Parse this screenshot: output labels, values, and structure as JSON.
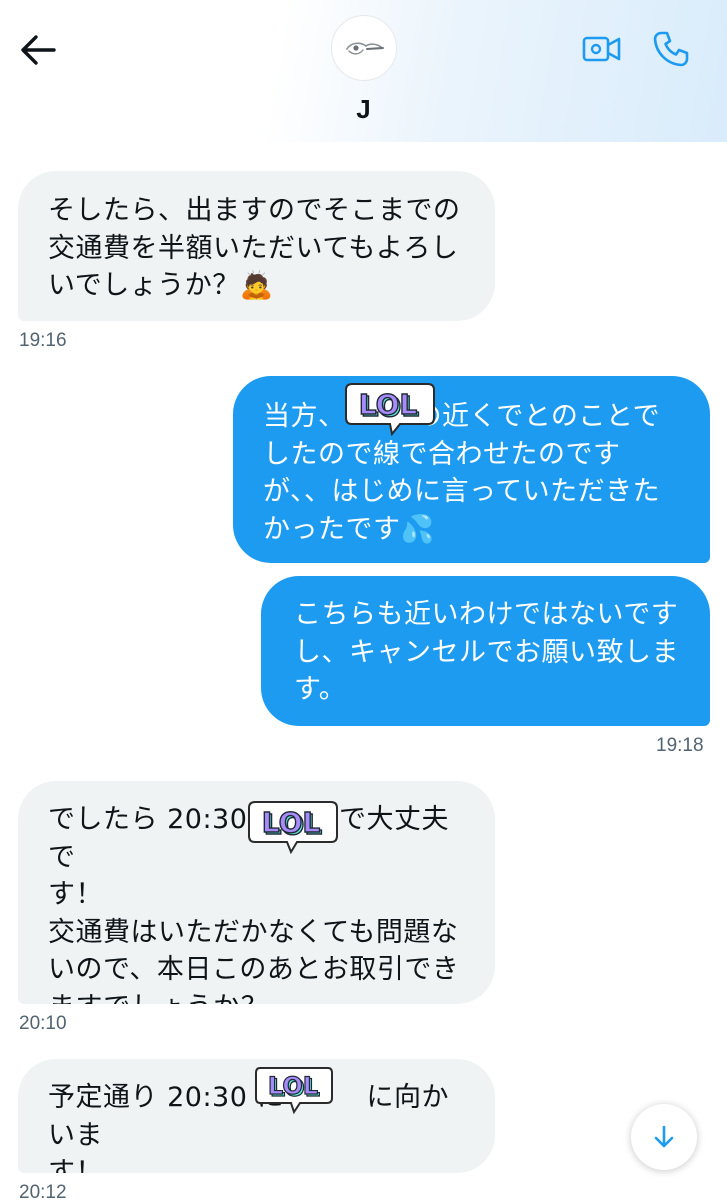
{
  "header": {
    "contact_name": "J",
    "icons": {
      "back": "arrow-left-icon",
      "video": "video-camera-icon",
      "phone": "phone-icon"
    }
  },
  "colors": {
    "accent": "#1d9bf0",
    "incoming_bubble": "#eff3f4",
    "timestamp": "#536471",
    "sticker_text": "#8b5cf6"
  },
  "sticker_text": "LOL",
  "messages": [
    {
      "direction": "incoming",
      "text": "そしたら、出ますのでそこまでの\n交通費を半額いただいてもよろし\nいでしょうか？🙇",
      "time": "19:16"
    },
    {
      "direction": "outgoing",
      "text": "当方、　　　の近くでとのことで\nしたので線で合わせたのです\nが、、はじめに言っていただきた\nかったです💦",
      "time": ""
    },
    {
      "direction": "outgoing",
      "text": "こちらも近いわけではないです\nし、キャンセルでお願い致しま\nす。",
      "time": "19:18"
    },
    {
      "direction": "incoming",
      "text": "でしたら 20:30 　　　で大丈夫で\nす！\n交通費はいただかなくても問題な\nいので、本日このあとお取引でき\nますでしょうか？",
      "time": "20:10"
    },
    {
      "direction": "incoming",
      "text": "予定通り 20:30 に　　　に向かいま\nす！",
      "time": "20:12"
    }
  ]
}
